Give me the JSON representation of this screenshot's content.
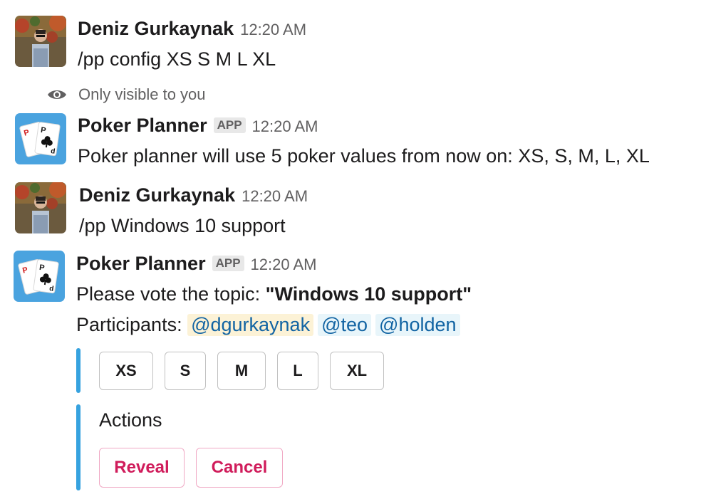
{
  "messages": [
    {
      "user": "Deniz Gurkaynak",
      "time": "12:20 AM",
      "text": "/pp config XS S M L XL"
    },
    {
      "visibility": "Only visible to you",
      "user": "Poker Planner",
      "badge": "APP",
      "time": "12:20 AM",
      "text": "Poker planner will use 5 poker values from now on: XS, S, M, L, XL"
    },
    {
      "user": "Deniz Gurkaynak",
      "time": "12:20 AM",
      "text": "/pp Windows 10 support"
    },
    {
      "user": "Poker Planner",
      "badge": "APP",
      "time": "12:20 AM",
      "vote_prefix": "Please vote the topic: ",
      "topic": "\"Windows 10 support\"",
      "participants_label": "Participants: ",
      "participants": [
        "@dgurkaynak",
        "@teo",
        "@holden"
      ]
    }
  ],
  "vote_options": [
    "XS",
    "S",
    "M",
    "L",
    "XL"
  ],
  "actions": {
    "title": "Actions",
    "reveal": "Reveal",
    "cancel": "Cancel"
  },
  "colors": {
    "accent_bar": "#36a2df",
    "danger": "#d01c5b",
    "mention_text": "#1264a3",
    "mention_self_bg": "#fcf2d6",
    "mention_bg": "#e8f5fa",
    "app_icon_bg": "#4aa3df"
  },
  "icons": {
    "user_avatar": "user-photo",
    "bot_avatar": "playing-cards-icon",
    "visibility": "eye-icon"
  }
}
